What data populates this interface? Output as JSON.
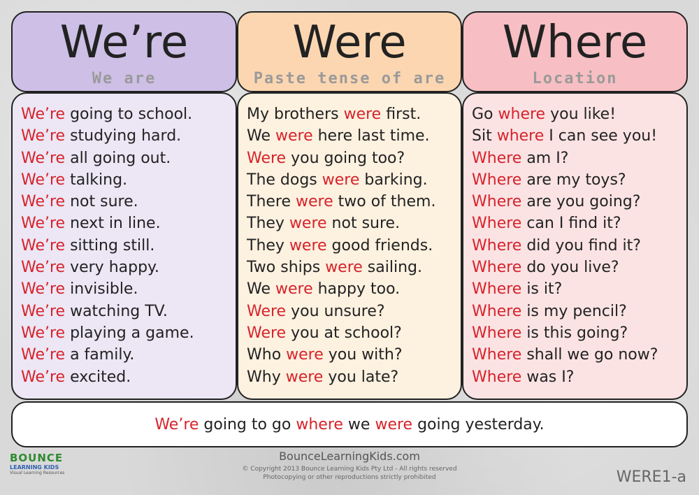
{
  "watermark": {
    "brand": "BOUNCE",
    "brand_line2": "LEARNING KIDS",
    "tagline": "Visual Learning Resources"
  },
  "columns": [
    {
      "title": "We’re",
      "subtitle": "We are",
      "header_color": "#cdbfe6",
      "body_color": "#ece6f5",
      "lines": [
        {
          "key": "We’re",
          "rest": " going to school."
        },
        {
          "key": "We’re",
          "rest": " studying hard."
        },
        {
          "key": "We’re",
          "rest": " all going out."
        },
        {
          "key": "We’re",
          "rest": " talking."
        },
        {
          "key": "We’re",
          "rest": " not sure."
        },
        {
          "key": "We’re",
          "rest": " next in line."
        },
        {
          "key": "We’re",
          "rest": " sitting still."
        },
        {
          "key": "We’re",
          "rest": " very happy."
        },
        {
          "key": "We’re",
          "rest": " invisible."
        },
        {
          "key": "We’re",
          "rest": " watching TV."
        },
        {
          "key": "We’re",
          "rest": " playing a game."
        },
        {
          "key": "We’re",
          "rest": " a family."
        },
        {
          "key": "We’re",
          "rest": " excited."
        }
      ]
    },
    {
      "title": "Were",
      "subtitle": "Paste tense of are",
      "header_color": "#fbd6b0",
      "body_color": "#fdf1e0",
      "lines": [
        {
          "pre": "My brothers ",
          "key": "were",
          "rest": " first."
        },
        {
          "pre": "We ",
          "key": "were",
          "rest": " here last time."
        },
        {
          "pre": "",
          "key": "Were",
          "rest": " you going too?"
        },
        {
          "pre": "The dogs ",
          "key": "were",
          "rest": " barking."
        },
        {
          "pre": "There ",
          "key": "were",
          "rest": " two of them."
        },
        {
          "pre": "They ",
          "key": "were",
          "rest": " not sure."
        },
        {
          "pre": "They ",
          "key": "were",
          "rest": " good friends."
        },
        {
          "pre": "Two ships ",
          "key": "were",
          "rest": " sailing."
        },
        {
          "pre": "We ",
          "key": "were",
          "rest": " happy too."
        },
        {
          "pre": "",
          "key": "Were",
          "rest": " you unsure?"
        },
        {
          "pre": "",
          "key": "Were",
          "rest": " you at school?"
        },
        {
          "pre": "Who ",
          "key": "were",
          "rest": " you with?"
        },
        {
          "pre": "Why ",
          "key": "were",
          "rest": " you late?"
        }
      ]
    },
    {
      "title": "Where",
      "subtitle": "Location",
      "header_color": "#f7bfc3",
      "body_color": "#fbe3e4",
      "lines": [
        {
          "pre": "Go ",
          "key": "where",
          "rest": " you like!"
        },
        {
          "pre": "Sit ",
          "key": "where",
          "rest": " I can see you!"
        },
        {
          "pre": "",
          "key": "Where",
          "rest": " am I?"
        },
        {
          "pre": "",
          "key": "Where",
          "rest": " are my toys?"
        },
        {
          "pre": "",
          "key": "Where",
          "rest": " are you going?"
        },
        {
          "pre": "",
          "key": "Where",
          "rest": " can I find it?"
        },
        {
          "pre": "",
          "key": "Where",
          "rest": " did you find it?"
        },
        {
          "pre": "",
          "key": "Where",
          "rest": " do you live?"
        },
        {
          "pre": "",
          "key": "Where",
          "rest": " is it?"
        },
        {
          "pre": "",
          "key": "Where",
          "rest": " is my pencil?"
        },
        {
          "pre": "",
          "key": "Where",
          "rest": " is this going?"
        },
        {
          "pre": "",
          "key": "Where",
          "rest": " shall we go now?"
        },
        {
          "pre": "",
          "key": "Where",
          "rest": " was I?"
        }
      ]
    }
  ],
  "summary": {
    "w1": "We’re",
    "t1": " going to go ",
    "w2": "where",
    "t2": " we ",
    "w3": "were",
    "t3": " going yesterday."
  },
  "footer": {
    "url": "BounceLearningKids.com",
    "copyright": "© Copyright 2013 Bounce Learning Kids Pty Ltd - All rights reserved",
    "notice": "Photocopying or other reproductions strictly prohibited",
    "code": "WERE1-a",
    "logo_line1": "BOUNCE",
    "logo_line2": "LEARNING KIDS",
    "logo_line3": "Visual Learning Resources"
  },
  "colors": {
    "accent_red": "#d6232a",
    "text": "#222222"
  }
}
